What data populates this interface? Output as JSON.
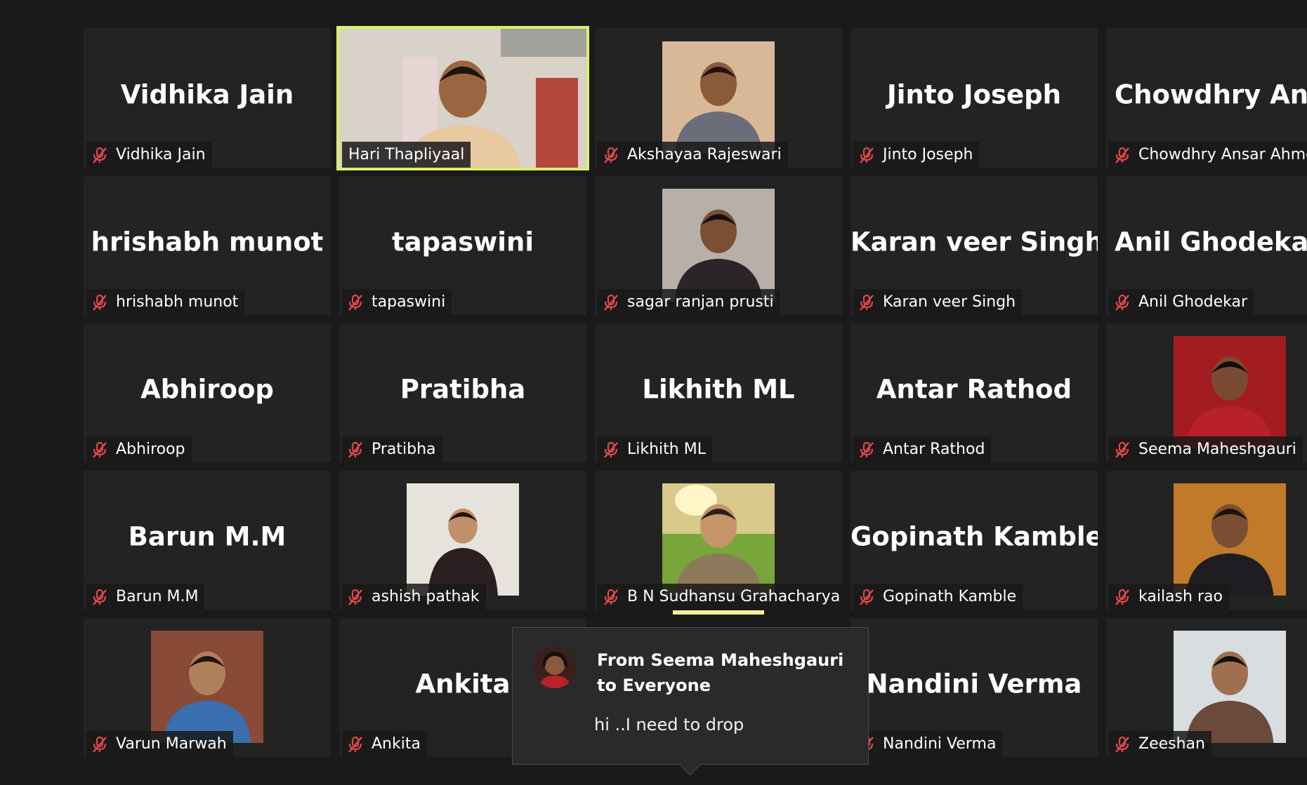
{
  "colors": {
    "background": "#1a1a1a",
    "tile": "#232323",
    "active_speaker_border": "#d9ef6a",
    "muted_mic": "#e0484c"
  },
  "participants": [
    {
      "name": "Vidhika Jain",
      "tile_text": "Vidhika Jain",
      "video": false,
      "muted": true
    },
    {
      "name": "Hari Thapliyaal",
      "video": true,
      "muted": false,
      "active": true
    },
    {
      "name": "Akshayaa Rajeswari",
      "video": true,
      "muted": true
    },
    {
      "name": "Jinto Joseph",
      "tile_text": "Jinto Joseph",
      "video": false,
      "muted": true
    },
    {
      "name": "Chowdhry Ansar Ahme",
      "tile_text": "Chowdhry  Ans",
      "video": false,
      "muted": true
    },
    {
      "name": "hrishabh munot",
      "tile_text": "hrishabh munot",
      "video": false,
      "muted": true
    },
    {
      "name": "tapaswini",
      "tile_text": "tapaswini",
      "video": false,
      "muted": true
    },
    {
      "name": "sagar ranjan prusti",
      "video": true,
      "muted": true
    },
    {
      "name": "Karan veer Singh",
      "tile_text": "Karan veer Singh",
      "video": false,
      "muted": true
    },
    {
      "name": "Anil Ghodekar",
      "tile_text": "Anil Ghodeka",
      "video": false,
      "muted": true
    },
    {
      "name": "Abhiroop",
      "tile_text": "Abhiroop",
      "video": false,
      "muted": true
    },
    {
      "name": "Pratibha",
      "tile_text": "Pratibha",
      "video": false,
      "muted": true
    },
    {
      "name": "Likhith ML",
      "tile_text": "Likhith ML",
      "video": false,
      "muted": true
    },
    {
      "name": "Antar Rathod",
      "tile_text": "Antar Rathod",
      "video": false,
      "muted": true
    },
    {
      "name": "Seema Maheshgauri",
      "video": true,
      "muted": true
    },
    {
      "name": "Barun M.M",
      "tile_text": "Barun M.M",
      "video": false,
      "muted": true
    },
    {
      "name": "ashish pathak",
      "video": true,
      "muted": true
    },
    {
      "name": "B N Sudhansu Grahacharya",
      "video": true,
      "muted": true
    },
    {
      "name": "Gopinath Kamble",
      "tile_text": "Gopinath Kamble",
      "video": false,
      "muted": true
    },
    {
      "name": "kailash rao",
      "video": true,
      "muted": true
    },
    {
      "name": "Varun Marwah",
      "video": true,
      "muted": true
    },
    {
      "name": "Ankita",
      "tile_text": "Ankita",
      "video": false,
      "muted": true
    },
    {
      "name": "",
      "video": false,
      "muted": false,
      "hidden": true
    },
    {
      "name": "Nandini Verma",
      "tile_text": "Nandini Verma",
      "video": false,
      "muted": true
    },
    {
      "name": "Zeeshan",
      "video": true,
      "muted": true
    }
  ],
  "chat_popup": {
    "from": "From Seema Maheshgauri to Everyone",
    "message": "hi ..I need to drop"
  }
}
